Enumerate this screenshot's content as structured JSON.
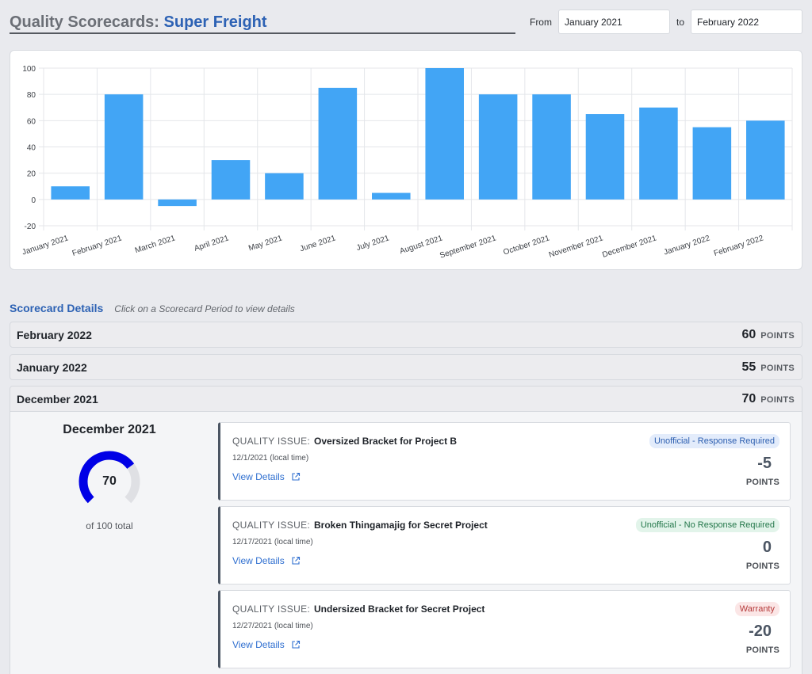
{
  "header": {
    "title": "Quality Scorecards:",
    "company": "Super Freight"
  },
  "range": {
    "from_label": "From",
    "from_value": "January 2021",
    "to_label": "to",
    "to_value": "February 2022"
  },
  "chart_data": {
    "type": "bar",
    "categories": [
      "January 2021",
      "February 2021",
      "March 2021",
      "April 2021",
      "May 2021",
      "June 2021",
      "July 2021",
      "August 2021",
      "September 2021",
      "October 2021",
      "November 2021",
      "December 2021",
      "January 2022",
      "February 2022"
    ],
    "values": [
      10,
      80,
      -5,
      30,
      20,
      85,
      5,
      100,
      80,
      80,
      65,
      70,
      55,
      60
    ],
    "ylim": [
      -20,
      100
    ],
    "yticks": [
      100,
      80,
      60,
      40,
      20,
      0,
      -20
    ],
    "bar_color": "#42a5f5",
    "grid": true
  },
  "details": {
    "title": "Scorecard Details",
    "hint": "Click on a Scorecard Period to view details"
  },
  "periods": [
    {
      "name": "February 2022",
      "points": "60",
      "unit": "POINTS"
    },
    {
      "name": "January 2022",
      "points": "55",
      "unit": "POINTS"
    },
    {
      "name": "December 2021",
      "points": "70",
      "unit": "POINTS"
    }
  ],
  "summary": {
    "month": "December 2021",
    "score": "70",
    "total_text": "of 100 total",
    "score_fraction": 0.7,
    "gauge_color": "#0000e6",
    "gauge_track": "#dfe0e4"
  },
  "issues": [
    {
      "label": "QUALITY ISSUE:",
      "title": "Oversized Bracket for Project B",
      "date": "12/1/2021 (local time)",
      "link": "View Details",
      "badge": "Unofficial - Response Required",
      "badge_bg": "#e3ecfb",
      "badge_fg": "#2d5fb0",
      "points": "-5",
      "unit": "POINTS"
    },
    {
      "label": "QUALITY ISSUE:",
      "title": "Broken Thingamajig for Secret Project",
      "date": "12/17/2021 (local time)",
      "link": "View Details",
      "badge": "Unofficial - No Response Required",
      "badge_bg": "#e2f4ea",
      "badge_fg": "#23774a",
      "points": "0",
      "unit": "POINTS"
    },
    {
      "label": "QUALITY ISSUE:",
      "title": "Undersized Bracket for Secret Project",
      "date": "12/27/2021 (local time)",
      "link": "View Details",
      "badge": "Warranty",
      "badge_bg": "#fbe6e6",
      "badge_fg": "#b53a3a",
      "points": "-20",
      "unit": "POINTS"
    }
  ]
}
